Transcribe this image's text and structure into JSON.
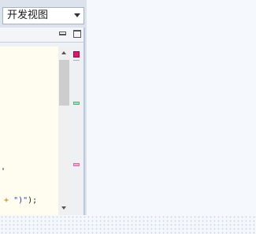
{
  "toolbar": {
    "view_select_value": "开发视图"
  },
  "panel": {
    "minimize_icon": "minimize-icon",
    "maximize_icon": "maximize-icon"
  },
  "editor": {
    "visible_code_plus": "+",
    "visible_code_string": "\")\"",
    "visible_code_end": ");"
  },
  "colors": {
    "error_marker": "#d8196d",
    "info_marker": "#9ee0b7",
    "warning_marker": "#f4a7cf",
    "editor_background": "#fffcf0"
  }
}
